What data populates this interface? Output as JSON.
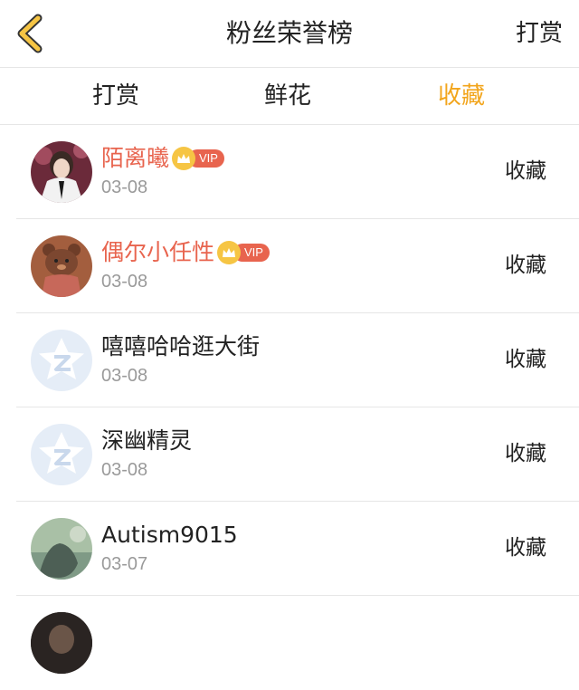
{
  "header": {
    "title": "粉丝荣誉榜",
    "right_action": "打赏",
    "accent_color": "#f2a51c"
  },
  "tabs": [
    {
      "label": "打赏",
      "active": false
    },
    {
      "label": "鲜花",
      "active": false
    },
    {
      "label": "收藏",
      "active": true
    }
  ],
  "rows": [
    {
      "name": "陌离曦",
      "date": "03-08",
      "action": "收藏",
      "vip": true,
      "vip_label": "VIP",
      "avatar": "photo-person"
    },
    {
      "name": "偶尔小任性",
      "date": "03-08",
      "action": "收藏",
      "vip": true,
      "vip_label": "VIP",
      "avatar": "bear-illustration"
    },
    {
      "name": "嘻嘻哈哈逛大街",
      "date": "03-08",
      "action": "收藏",
      "vip": false,
      "avatar": "default-star"
    },
    {
      "name": "深幽精灵",
      "date": "03-08",
      "action": "收藏",
      "vip": false,
      "avatar": "default-star"
    },
    {
      "name": "Autism9015",
      "date": "03-07",
      "action": "收藏",
      "vip": false,
      "avatar": "photo-landscape"
    }
  ],
  "colors": {
    "vip_name": "#e8644e",
    "date": "#9a9a9a",
    "divider": "#e6e6e6",
    "crown": "#f6c544"
  }
}
